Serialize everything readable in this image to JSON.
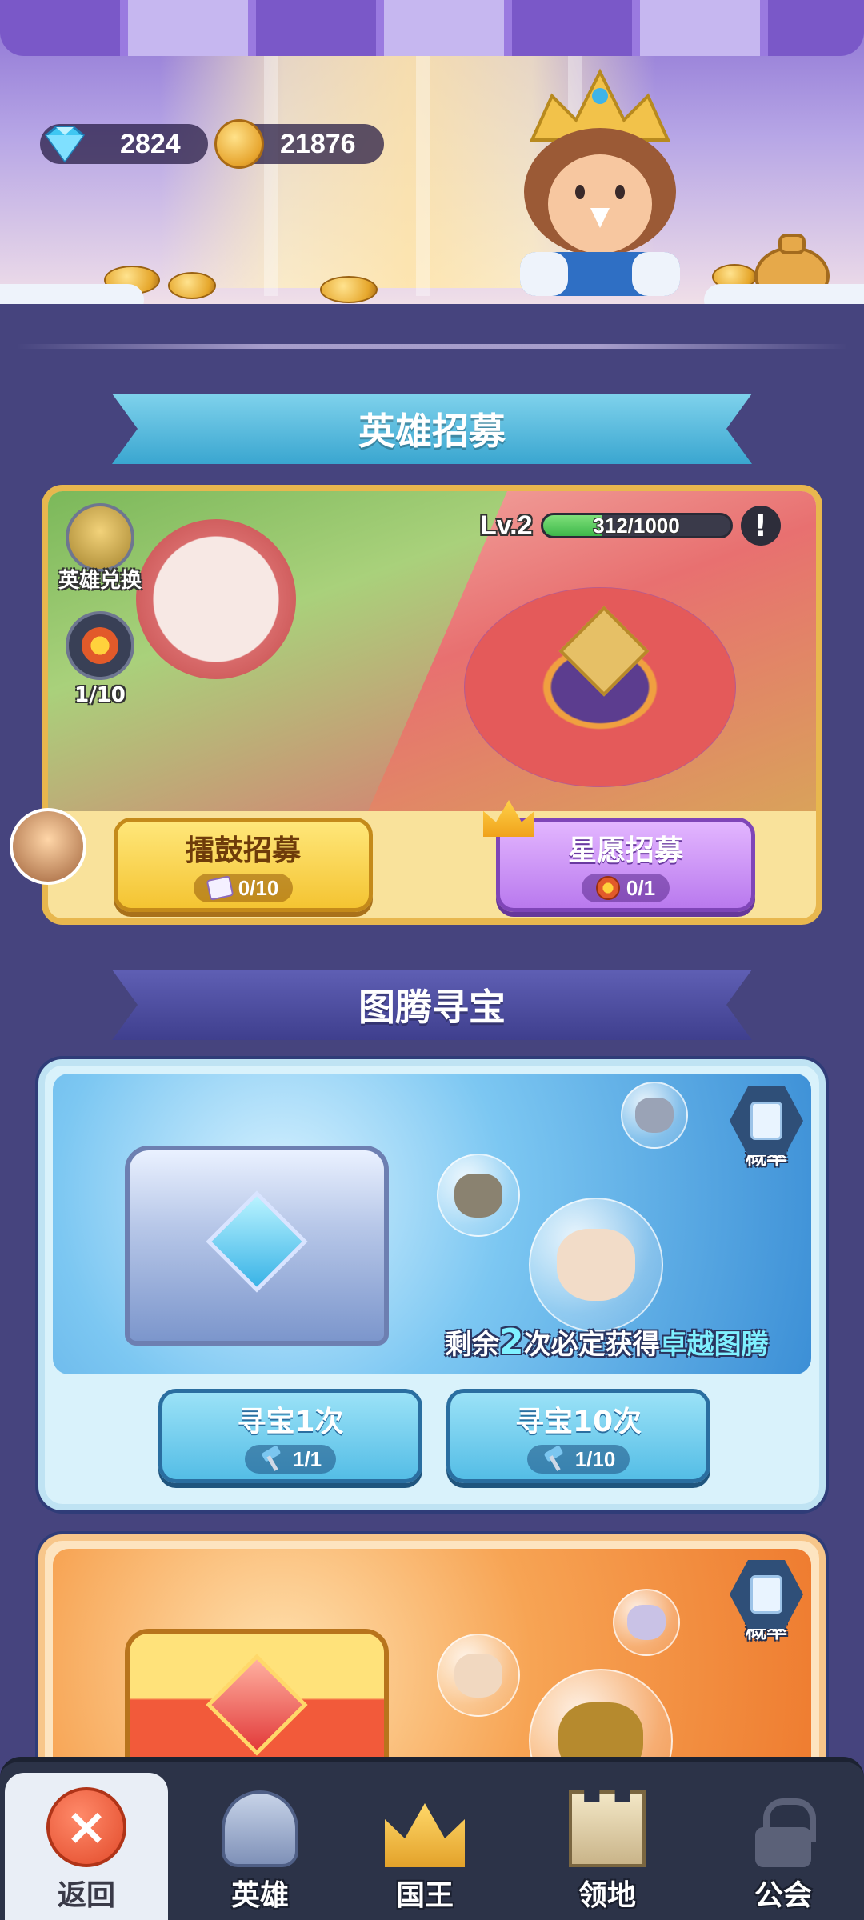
{
  "currencies": {
    "gems": "2824",
    "coins": "21876"
  },
  "sections": {
    "recruit_title": "英雄招募",
    "totem_title": "图腾寻宝"
  },
  "recruit": {
    "hero_exchange_label": "英雄兑换",
    "token_progress": "1/10",
    "level": "Lv.2",
    "level_progress_text": "312/1000",
    "level_progress_fraction": 0.312,
    "alert_symbol": "!",
    "drum_button": {
      "title": "擂鼓招募",
      "cost": "0/10",
      "cost_icon": "ticket-icon"
    },
    "star_button": {
      "title": "星愿招募",
      "cost": "0/1",
      "cost_icon": "token-icon"
    }
  },
  "totem_blue": {
    "odds_label": "概率",
    "guarantee_prefix": "剩余",
    "guarantee_count": "2",
    "guarantee_mid": "次必定获得",
    "guarantee_highlight": "卓越图腾",
    "buttons": [
      {
        "title": "寻宝1次",
        "cost": "1/1",
        "cost_icon": "hammer-icon"
      },
      {
        "title": "寻宝10次",
        "cost": "1/10",
        "cost_icon": "hammer-icon"
      }
    ]
  },
  "totem_orange": {
    "odds_label": "概率"
  },
  "nav": {
    "back": "返回",
    "heroes": "英雄",
    "king": "国王",
    "territory": "领地",
    "guild": "公会"
  },
  "colors": {
    "background": "#46447e",
    "ribbon_blue": "#3aa6d0",
    "btn_yellow": "#f4c432",
    "btn_purple": "#b979ee",
    "btn_blue": "#54bde6",
    "nav_bg": "#2c3348",
    "level_fill": "#3db84a"
  }
}
